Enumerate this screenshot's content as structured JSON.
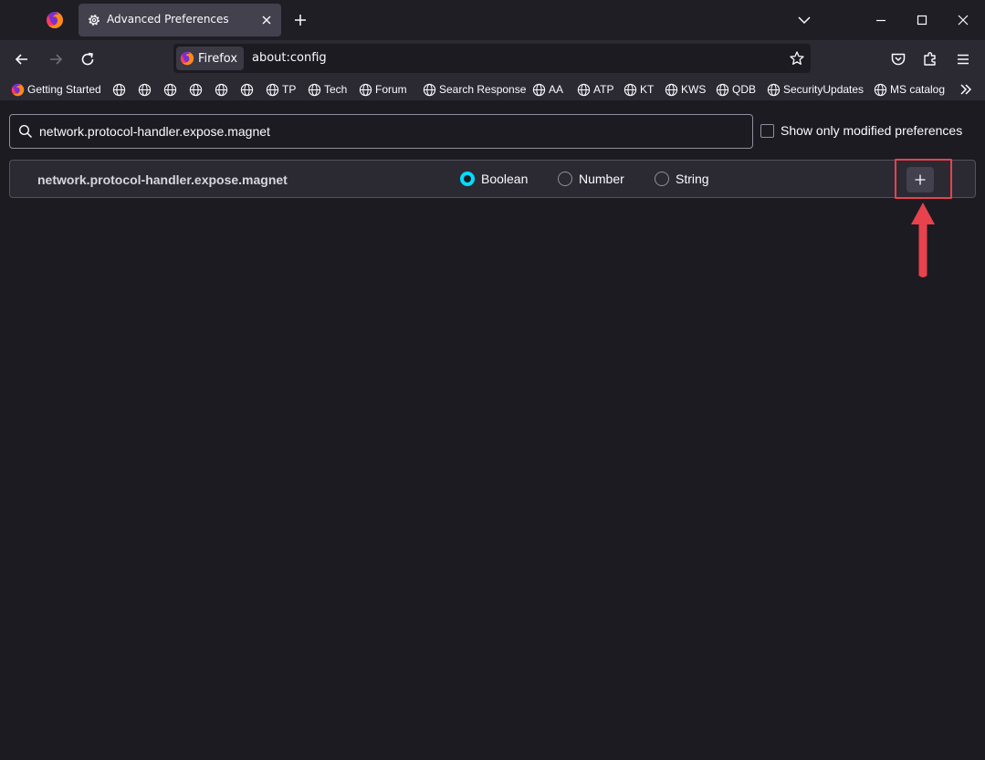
{
  "tab": {
    "title": "Advanced Preferences"
  },
  "urlbar": {
    "identity_label": "Firefox",
    "url": "about:config"
  },
  "bookmarks": [
    {
      "label": "Getting Started",
      "icon": "firefox-icon"
    },
    {
      "label": "",
      "icon": "globe-icon"
    },
    {
      "label": "",
      "icon": "globe-icon"
    },
    {
      "label": "",
      "icon": "globe-icon"
    },
    {
      "label": "",
      "icon": "globe-icon"
    },
    {
      "label": "",
      "icon": "globe-icon"
    },
    {
      "label": "",
      "icon": "globe-icon"
    },
    {
      "label": "TP",
      "icon": "globe-icon"
    },
    {
      "label": "Tech",
      "icon": "globe-icon"
    },
    {
      "label": "Forum",
      "icon": "globe-icon"
    },
    {
      "label": "Search Response",
      "icon": "globe-icon"
    },
    {
      "label": "AA",
      "icon": "globe-icon"
    },
    {
      "label": "ATP",
      "icon": "globe-icon"
    },
    {
      "label": "KT",
      "icon": "globe-icon"
    },
    {
      "label": "KWS",
      "icon": "globe-icon"
    },
    {
      "label": "QDB",
      "icon": "globe-icon"
    },
    {
      "label": "SecurityUpdates",
      "icon": "globe-icon"
    },
    {
      "label": "MS catalog",
      "icon": "globe-icon"
    }
  ],
  "config": {
    "search_value": "network.protocol-handler.expose.magnet",
    "modified_label": "Show only modified preferences",
    "modified_checked": false,
    "new_pref": {
      "name": "network.protocol-handler.expose.magnet",
      "types": [
        {
          "label": "Boolean",
          "selected": true
        },
        {
          "label": "Number",
          "selected": false
        },
        {
          "label": "String",
          "selected": false
        }
      ]
    }
  },
  "colors": {
    "accent": "#00ddff",
    "annotation": "#e8424d",
    "background": "#1c1b22",
    "toolbar": "#2b2a33"
  }
}
